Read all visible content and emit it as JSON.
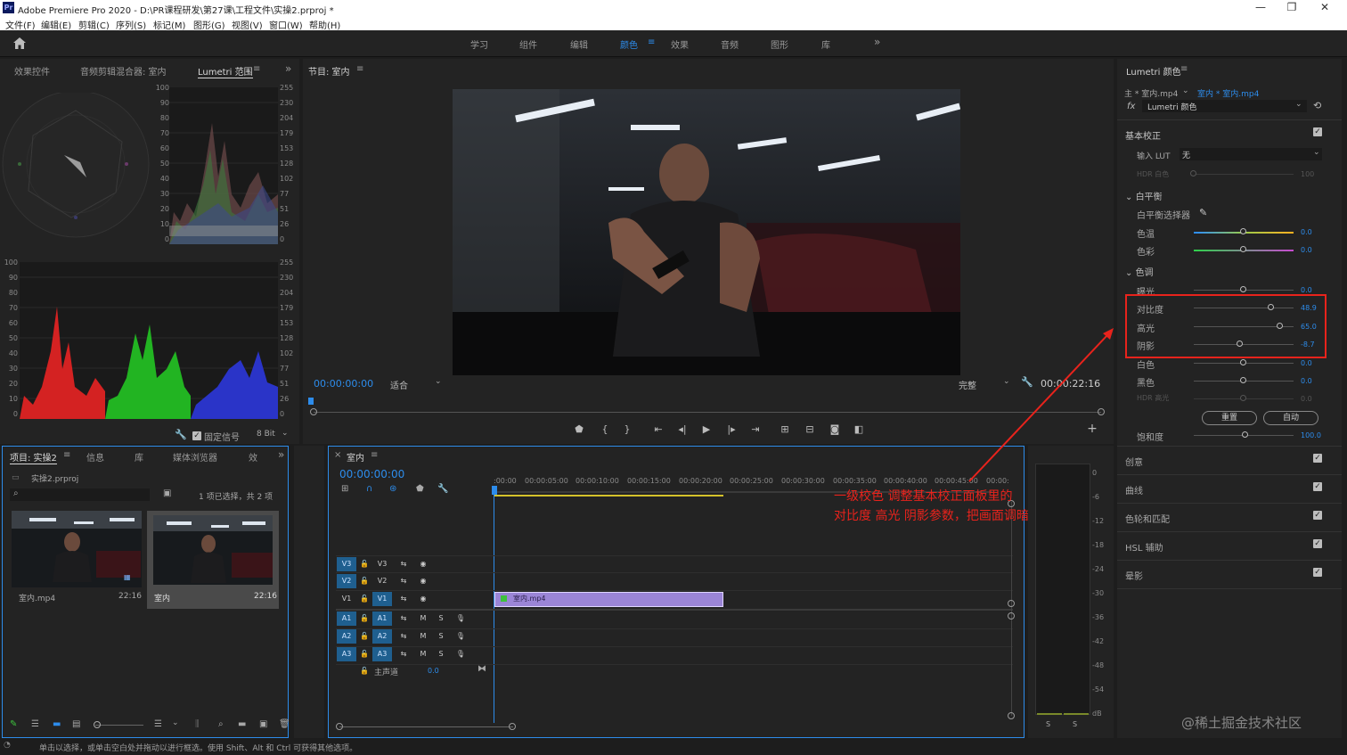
{
  "window": {
    "title": "Adobe Premiere Pro 2020 - D:\\PR课程研发\\第27课\\工程文件\\实操2.prproj *",
    "app_icon": "Pr",
    "controls": [
      "—",
      "❐",
      "✕"
    ]
  },
  "menu": [
    "文件(F)",
    "编辑(E)",
    "剪辑(C)",
    "序列(S)",
    "标记(M)",
    "图形(G)",
    "视图(V)",
    "窗口(W)",
    "帮助(H)"
  ],
  "workspaces": [
    "学习",
    "组件",
    "编辑",
    "颜色",
    "效果",
    "音频",
    "图形",
    "库"
  ],
  "workspace_active": "颜色",
  "workspace_more": "»",
  "left_panel": {
    "tabs": [
      "效果控件",
      "音频剪辑混合器: 室内",
      "Lumetri 范围"
    ],
    "menu_icon": "≡",
    "scale_left": [
      "100",
      "90",
      "80",
      "70",
      "60",
      "50",
      "40",
      "30",
      "20",
      "10",
      "0"
    ],
    "scale_right": [
      "255",
      "230",
      "204",
      "179",
      "153",
      "128",
      "102",
      "77",
      "51",
      "26",
      "0"
    ],
    "fixed_signal": "固定信号",
    "bit_depth": "8 Bit"
  },
  "program_monitor": {
    "tab": "节目: 室内",
    "timecode": "00:00:00:00",
    "fit": "适合",
    "quality": "完整",
    "duration": "00:00:22:16"
  },
  "project_panel": {
    "tabs": [
      "项目: 实操2",
      "信息",
      "库",
      "媒体浏览器",
      "效"
    ],
    "file": "实操2.prproj",
    "selection_info": "1 项已选择，共 2 项",
    "items": [
      {
        "name": "室内.mp4",
        "duration": "22:16"
      },
      {
        "name": "室内",
        "duration": "22:16"
      }
    ]
  },
  "timeline": {
    "tab": "室内",
    "timecode": "00:00:00:00",
    "ruler": [
      ":00:00",
      "00:00:05:00",
      "00:00:10:00",
      "00:00:15:00",
      "00:00:20:00",
      "00:00:25:00",
      "00:00:30:00",
      "00:00:35:00",
      "00:00:40:00",
      "00:00:45:00",
      "00:00:"
    ],
    "video_tracks": [
      "V3",
      "V2",
      "V1"
    ],
    "audio_tracks": [
      "A1",
      "A2",
      "A3"
    ],
    "master": "主声道",
    "master_value": "0.0",
    "clip": "室内.mp4",
    "annotation_line1": "一级校色 调整基本校正面板里的",
    "annotation_line2": "对比度 高光 阴影参数，把画面调暗"
  },
  "audio_meter": {
    "scale": [
      "0",
      "-6",
      "-12",
      "-18",
      "-24",
      "-30",
      "-36",
      "-42",
      "-48",
      "-54",
      "dB"
    ],
    "solo": [
      "S",
      "S"
    ]
  },
  "lumetri": {
    "title": "Lumetri 颜色",
    "source": "主 * 室内.mp4",
    "target": "室内 * 室内.mp4",
    "fx": "fx",
    "effect": "Lumetri 颜色",
    "basic_correction": "基本校正",
    "input_lut_label": "输入 LUT",
    "input_lut_value": "无",
    "hdr_white": "HDR 白色",
    "hdr_white_value": "100",
    "white_balance": "白平衡",
    "wb_selector": "白平衡选择器",
    "tone": "色调",
    "sliders": [
      {
        "label": "色温",
        "value": "0.0",
        "pos": 0.5
      },
      {
        "label": "色彩",
        "value": "0.0",
        "pos": 0.5
      },
      {
        "label": "曝光",
        "value": "0.0",
        "pos": 0.5
      },
      {
        "label": "对比度",
        "value": "48.9",
        "pos": 0.78
      },
      {
        "label": "高光",
        "value": "65.0",
        "pos": 0.87
      },
      {
        "label": "阴影",
        "value": "-8.7",
        "pos": 0.46
      },
      {
        "label": "白色",
        "value": "0.0",
        "pos": 0.5
      },
      {
        "label": "黑色",
        "value": "0.0",
        "pos": 0.5
      },
      {
        "label": "HDR 高光",
        "value": "0.0",
        "pos": 0.5
      }
    ],
    "reset": "重置",
    "auto": "自动",
    "saturation": "饱和度",
    "saturation_value": "100.0",
    "sections": [
      "创意",
      "曲线",
      "色轮和匹配",
      "HSL 辅助",
      "晕影"
    ]
  },
  "status_bar": "单击以选择，或单击空白处并拖动以进行框选。使用 Shift、Alt 和 Ctrl 可获得其他选项。",
  "watermark": "@稀土掘金技术社区",
  "colors": {
    "accent": "#2d8ceb",
    "annotation": "#e8231c",
    "clip": "#9b85d6",
    "track_blue": "#1f5f8f"
  }
}
